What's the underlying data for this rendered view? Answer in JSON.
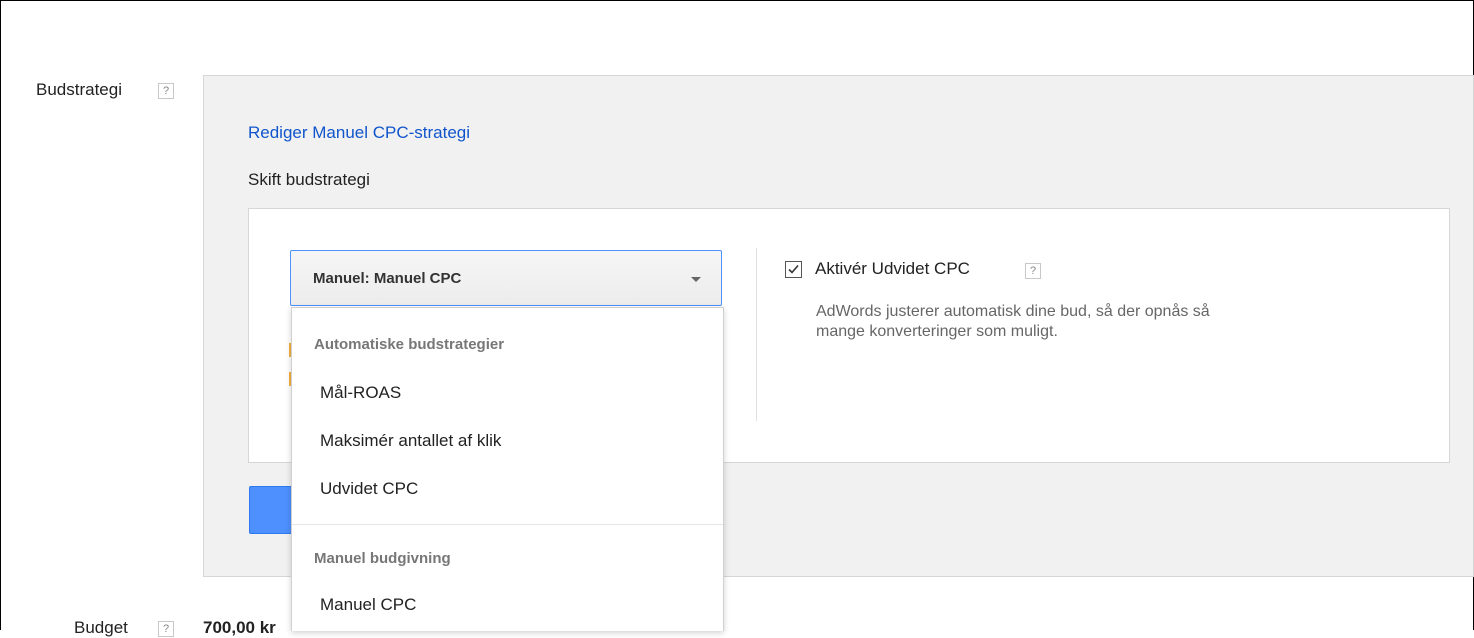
{
  "bid_strategy": {
    "label": "Budstrategi",
    "help": "?",
    "edit_link": "Rediger Manuel CPC-strategi",
    "change_label": "Skift budstrategi",
    "select": {
      "value": "Manuel: Manuel CPC"
    },
    "dropdown": {
      "groups": [
        {
          "title": "Automatiske budstrategier",
          "items": [
            "Mål-ROAS",
            "Maksimér antallet af klik",
            "Udvidet CPC"
          ]
        },
        {
          "title": "Manuel budgivning",
          "items": [
            "Manuel CPC"
          ]
        }
      ]
    },
    "enhanced_cpc": {
      "label": "Aktivér Udvidet CPC",
      "help": "?",
      "checked": true,
      "description": "AdWords justerer automatisk dine bud, så der opnås så mange konverteringer som muligt."
    }
  },
  "budget": {
    "label": "Budget",
    "help": "?",
    "value": "700,00 kr"
  },
  "colors": {
    "link": "#1155cc",
    "select_border": "#4d90fe",
    "primary_button": "#4d90fe",
    "panel_bg": "#f1f1f1"
  }
}
